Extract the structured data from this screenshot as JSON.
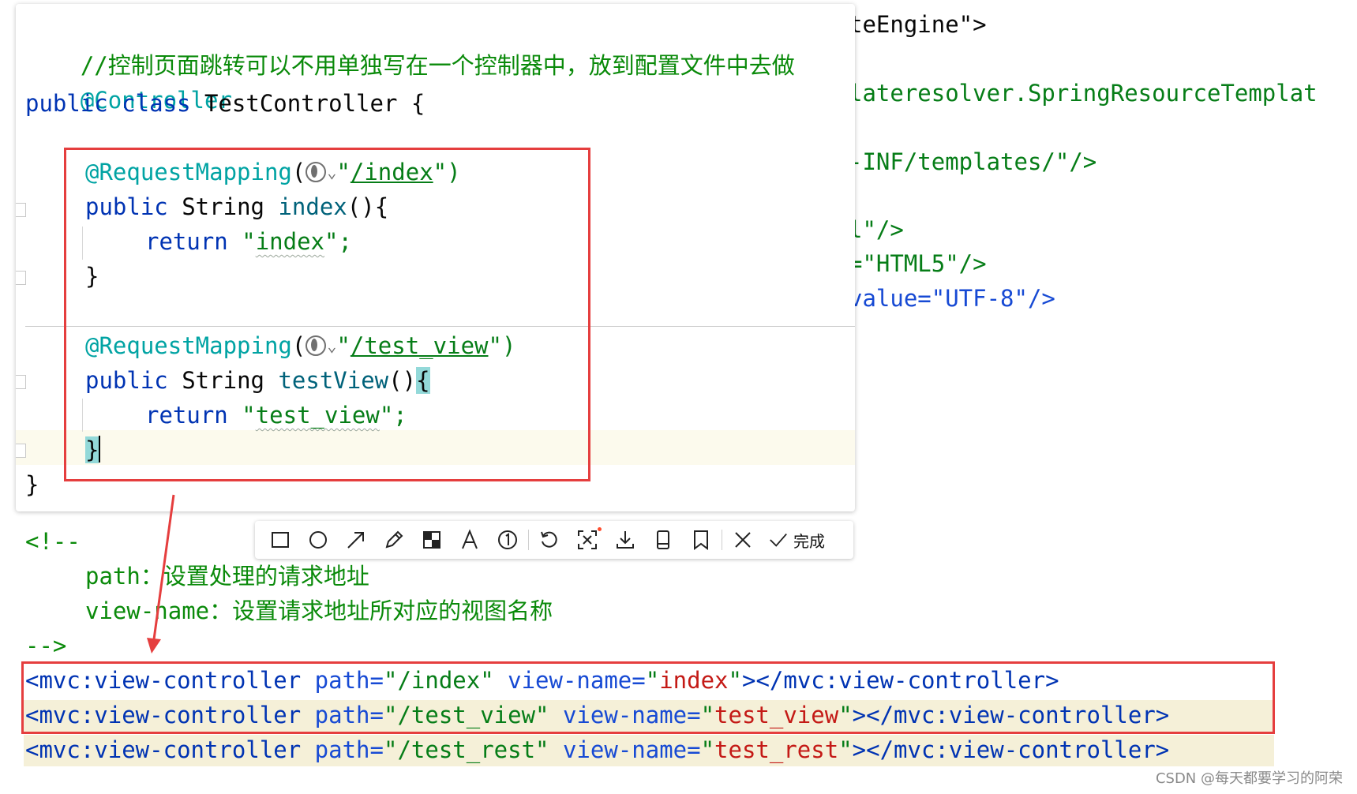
{
  "background_code": [
    "teEngine\">",
    "lateresolver.SpringResourceTemplat",
    "-INF/templates/\"/>",
    "l\"/>",
    "=\"HTML5\"/>",
    "value=\"UTF-8\"/>"
  ],
  "java": {
    "comment": "//控制页面跳转可以不用单独写在一个控制器中，放到配置文件中去做",
    "annotation_controller": "@Controller",
    "class_kw": "public class",
    "class_name": " TestController {",
    "req_mapping": "@RequestMapping",
    "paren_open": "(",
    "path_index": "/index",
    "path_test_view": "/test_view",
    "paren_close": "\")",
    "public_kw": "public",
    "string_type": " String ",
    "method_index": "index",
    "method_test_view": "testView",
    "parens": "()",
    "brace_open": "{",
    "return_kw": "return",
    "ret_index": "index",
    "ret_test_view": "test_view",
    "semicolon": "\";",
    "brace_close": "}",
    "quote": "\""
  },
  "toolbar": {
    "icons": [
      "rectangle-icon",
      "circle-icon",
      "arrow-icon",
      "pencil-icon",
      "mosaic-icon",
      "text-icon",
      "number-icon",
      "undo-icon",
      "ocr-icon",
      "download-icon",
      "pin-icon",
      "bookmark-icon",
      "close-icon",
      "check-icon"
    ],
    "done_label": "完成"
  },
  "xml": {
    "comment_open": "<!--",
    "path_label": "path：",
    "path_desc": "设置处理的请求地址",
    "viewname_label": "view-name：",
    "viewname_desc": "设置请求地址所对应的视图名称",
    "comment_close": "-->",
    "rows": [
      {
        "path": "/index",
        "view": "index"
      },
      {
        "path": "/test_view",
        "view": "test_view"
      },
      {
        "path": "/test_rest",
        "view": "test_rest"
      }
    ],
    "tag_open": "<",
    "tag_name": "mvc:view-controller",
    "attr_path": " path=",
    "attr_view": " view-name=",
    "close_part": "></",
    "tag_end": ">"
  },
  "watermark": "CSDN @每天都要学习的阿荣"
}
